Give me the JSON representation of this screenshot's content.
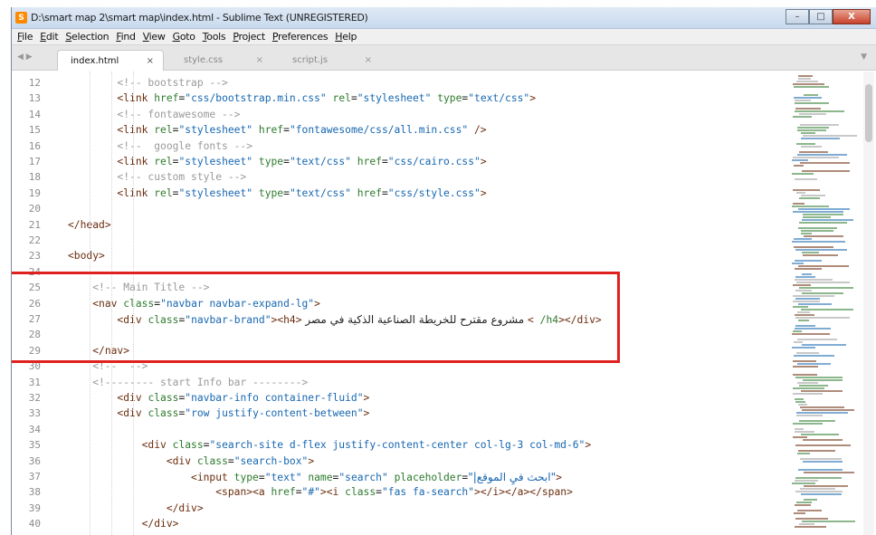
{
  "window": {
    "title": "D:\\smart map 2\\smart map\\index.html - Sublime Text (UNREGISTERED)",
    "app_icon_glyph": "S",
    "minimize_glyph": "–",
    "maximize_glyph": "□",
    "close_glyph": "X"
  },
  "menu": [
    "File",
    "Edit",
    "Selection",
    "Find",
    "View",
    "Goto",
    "Tools",
    "Project",
    "Preferences",
    "Help"
  ],
  "tabs": [
    {
      "label": "index.html",
      "close": "×",
      "active": true
    },
    {
      "label": "style.css",
      "close": "×",
      "active": false
    },
    {
      "label": "script.js",
      "close": "×",
      "active": false
    }
  ],
  "tab_arrows": "◀ ▶",
  "tab_dropdown": "▼",
  "line_numbers": [
    "12",
    "13",
    "14",
    "15",
    "16",
    "17",
    "18",
    "19",
    "20",
    "21",
    "22",
    "23",
    "24",
    "25",
    "26",
    "27",
    "28",
    "29",
    "30",
    "31",
    "32",
    "33",
    "34",
    "35",
    "36",
    "37",
    "38",
    "39",
    "40"
  ],
  "code_lines": [
    "        <!-- bootstrap -->",
    "        <link href=\"css/bootstrap.min.css\" rel=\"stylesheet\" type=\"text/css\">",
    "        <!-- fontawesome -->",
    "        <link rel=\"stylesheet\" href=\"fontawesome/css/all.min.css\" />",
    "        <!--  google fonts -->",
    "        <link rel=\"stylesheet\" type=\"text/css\" href=\"css/cairo.css\">",
    "        <!-- custom style -->",
    "        <link rel=\"stylesheet\" type=\"text/css\" href=\"css/style.css\">",
    "",
    "</head>",
    "",
    "<body>",
    "",
    "    <!-- Main Title -->",
    "    <nav class=\"navbar navbar-expand-lg\">",
    "        <div class=\"navbar-brand\"><h4> مشروع مقترح للخريطة الصناعية الذكية في مصر < /h4></div>",
    "",
    "    </nav>",
    "    <!--  -->",
    "    <!-------- start Info bar -------->",
    "        <div class=\"navbar-info container-fluid\">",
    "        <div class=\"row justify-content-between\">",
    "",
    "            <div class=\"search-site d-flex justify-content-center col-lg-3 col-md-6\">",
    "                <div class=\"search-box\">",
    "                    <input type=\"text\" name=\"search\" placeholder=\"|ابحث فيِ الموقع\">",
    "                        <span><a href=\"#\"><i class=\"fas fa-search\"></i></a></span>",
    "                </div>",
    "            </div>"
  ],
  "colors": {
    "comment": "#9a9a9a",
    "tag": "#6b2d0e",
    "attribute": "#2d7a2d",
    "string": "#1767b0",
    "highlight_box": "#e0201f"
  }
}
